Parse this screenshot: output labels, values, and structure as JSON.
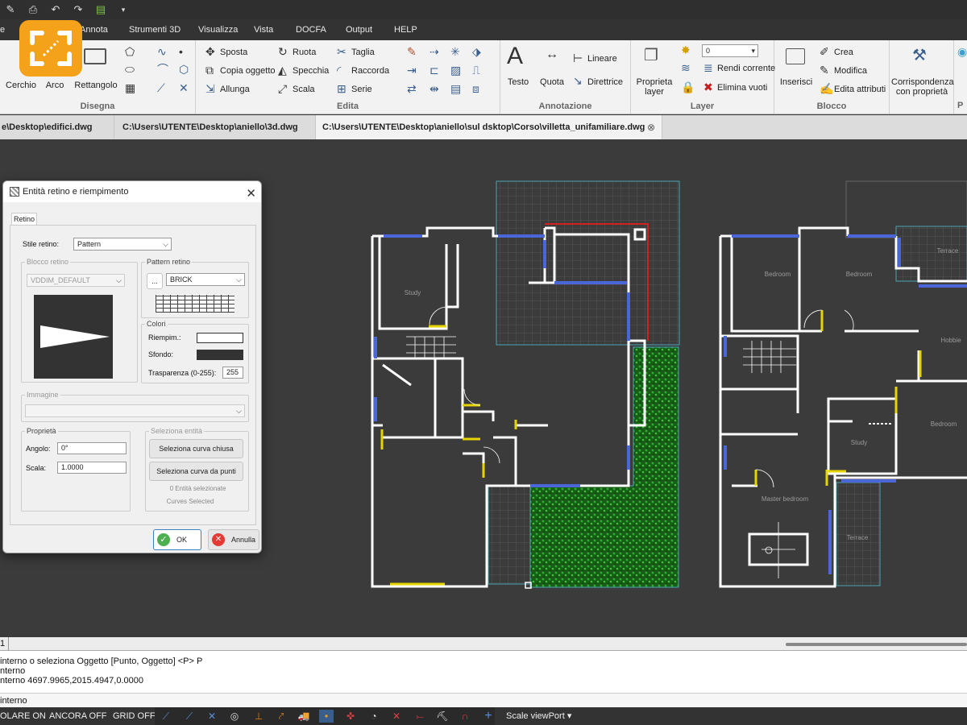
{
  "quick_access": {
    "icons": [
      "save-icon",
      "print-icon",
      "undo-icon",
      "redo-icon",
      "layer-icon",
      "dropdown-icon"
    ]
  },
  "menu": {
    "items": [
      "e",
      "Annota",
      "Strumenti 3D",
      "Visualizza",
      "Vista",
      "DOCFA",
      "Output",
      "HELP"
    ]
  },
  "ribbon": {
    "disegna": {
      "title": "Disegna",
      "cerchio": "Cerchio",
      "arco": "Arco",
      "rettangolo": "Rettangolo"
    },
    "edita": {
      "title": "Edita",
      "sposta": "Sposta",
      "copia": "Copia oggetto",
      "allunga": "Allunga",
      "ruota": "Ruota",
      "specchia": "Specchia",
      "scala": "Scala",
      "taglia": "Taglia",
      "raccorda": "Raccorda",
      "serie": "Serie"
    },
    "annotazione": {
      "title": "Annotazione",
      "testo": "Testo",
      "quota": "Quota",
      "lineare": "Lineare",
      "direttrice": "Direttrice"
    },
    "layer": {
      "title": "Layer",
      "proprieta": "Proprieta layer",
      "current_layer": "0",
      "rendi_corrente": "Rendi corrente",
      "elimina_vuoti": "Elimina vuoti"
    },
    "blocco": {
      "title": "Blocco",
      "inserisci": "Inserisci",
      "crea": "Crea",
      "modifica": "Modifica",
      "edita_attributi": "Edita attributi"
    },
    "corrispondenza": {
      "label": "Corrispondenza con proprietà",
      "next_title": "P"
    }
  },
  "doc_tabs": [
    {
      "label": "e\\Desktop\\edifici.dwg",
      "active": false
    },
    {
      "label": "C:\\Users\\UTENTE\\Desktop\\aniello\\3d.dwg",
      "active": false
    },
    {
      "label": "C:\\Users\\UTENTE\\Desktop\\aniello\\sul dsktop\\Corso\\villetta_unifamiliare.dwg",
      "active": true
    }
  ],
  "dialog": {
    "title": "Entità retino e riempimento",
    "tab": "Retino",
    "stile_label": "Stile retino:",
    "stile_value": "Pattern",
    "blocco_group": "Blocco retino",
    "blocco_value": "VDDIM_DEFAULT",
    "pattern_group": "Pattern retino",
    "pattern_browse": "...",
    "pattern_value": "BRICK",
    "colori_group": "Colori",
    "riempim_label": "Riempim.:",
    "sfondo_label": "Sfondo:",
    "trasparenza_label": "Trasparenza (0-255):",
    "trasparenza_value": "255",
    "immagine_group": "Immagine",
    "proprieta_group": "Proprietà",
    "angolo_label": "Angolo:",
    "angolo_value": "0°",
    "scala_label": "Scala:",
    "scala_value": "1.0000",
    "seleziona_group": "Seleziona entità",
    "btn_curva_chiusa": "Seleziona curva chiusa",
    "btn_curva_punti": "Seleziona curva da punti",
    "entita_selezionate": "0 Entità selezionate",
    "curves_selected": "Curves Selected",
    "ok": "OK",
    "annulla": "Annulla",
    "fill_color": "#ffffff",
    "bg_color": "#333333"
  },
  "plan_labels": {
    "study1": "Study",
    "bedroom1": "Bedroom",
    "bedroom2": "Bedroom",
    "terrace1": "Terrace",
    "hobbie": "Hobbie",
    "bedroom3": "Bedroom",
    "study2": "Study",
    "master": "Master bedroom",
    "terrace2": "Terrace"
  },
  "scroll_row": {
    "text": "1"
  },
  "command_history": [
    "interno o seleziona Oggetto [Punto, Oggetto] <P> P",
    "nterno",
    "nterno 4697.9965,2015.4947,0.0000"
  ],
  "command_input": "interno",
  "status": {
    "polare": "OLARE ON",
    "ancora": "ANCORA OFF",
    "grid": "GRID OFF",
    "scale_viewport": "Scale viewPort"
  },
  "colors": {
    "accent": "#f4a21a",
    "wall": "#ffffff",
    "window": "#4a66d8",
    "door": "#e6d400",
    "grass": "#1f7a1f",
    "grid": "#4aa3b5"
  }
}
